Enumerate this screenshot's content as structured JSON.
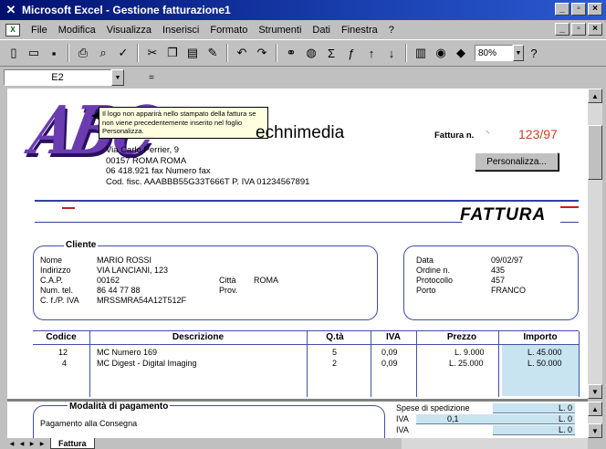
{
  "window": {
    "title": "Microsoft Excel - Gestione fatturazione1",
    "min": "_",
    "max": "▫",
    "close": "×"
  },
  "menu": [
    "File",
    "Modifica",
    "Visualizza",
    "Inserisci",
    "Formato",
    "Strumenti",
    "Dati",
    "Finestra",
    "?"
  ],
  "toolbar": {
    "zoom": "80%",
    "icons": [
      "new-icon",
      "open-icon",
      "save-icon",
      "print-icon",
      "print-preview-icon",
      "spellcheck-icon",
      "cut-icon",
      "copy-icon",
      "paste-icon",
      "format-painter-icon",
      "undo-icon",
      "redo-icon",
      "hyperlink-icon",
      "web-toolbar-icon",
      "autosum-icon",
      "function-icon",
      "sort-asc-icon",
      "sort-desc-icon",
      "chart-wizard-icon",
      "map-icon",
      "drawing-icon"
    ]
  },
  "formula": {
    "cell_ref": "E2",
    "equals": "="
  },
  "logo_text": "ABC",
  "tooltip": "Il logo non apparirà nello stampato della fattura se non viene precedentemente inserito nel foglio Personalizza.",
  "company": {
    "name": "echnimedia",
    "addr1": "Via Carlo Perrier, 9",
    "addr2": "00157  ROMA  ROMA",
    "addr3": "06 418.921 fax Numero fax",
    "addr4": "Cod. fisc.  AAABBB55G33T666T   P. IVA  01234567891"
  },
  "invoice": {
    "label": "Fattura n.",
    "number": "123/97",
    "personalize_btn": "Personalizza...",
    "title": "FATTURA"
  },
  "client": {
    "heading": "Cliente",
    "labels": [
      "Nome",
      "Indirizzo",
      "C.A.P.",
      "Num. tel.",
      "C. f./P. IVA"
    ],
    "values": [
      "MARIO ROSSI",
      "VIA LANCIANI, 123",
      "00162",
      "86 44 77 88",
      "MRSSMRA54A12T512F"
    ],
    "city_label": "Città",
    "city_value": "ROMA",
    "prov_label": "Prov."
  },
  "details": {
    "labels": [
      "Data",
      "Ordine n.",
      "Protocollo",
      "Porto"
    ],
    "values": [
      "09/02/97",
      "435",
      "457",
      "FRANCO"
    ]
  },
  "items": {
    "headers": [
      "Codice",
      "Descrizione",
      "Q.tà",
      "IVA",
      "Prezzo",
      "Importo"
    ],
    "rows": [
      {
        "code": "12",
        "desc": "MC Numero 169",
        "qty": "5",
        "iva": "0,09",
        "price": "L. 9.000",
        "amount": "L. 45.000"
      },
      {
        "code": "4",
        "desc": "MC Digest - Digital Imaging",
        "qty": "2",
        "iva": "0,09",
        "price": "L. 25.000",
        "amount": "L. 50.000"
      }
    ]
  },
  "payment": {
    "heading": "Modalità di pagamento",
    "value": "Pagamento alla Consegna",
    "ship_label": "Spese di spedizione",
    "ship_value": "L. 0",
    "iva_label": "IVA",
    "iva_rate": "0,1",
    "iva_value": "L. 0",
    "iva2_label": "IVA",
    "iva2_value": "L. 0"
  },
  "sheet_tab": "Fattura"
}
